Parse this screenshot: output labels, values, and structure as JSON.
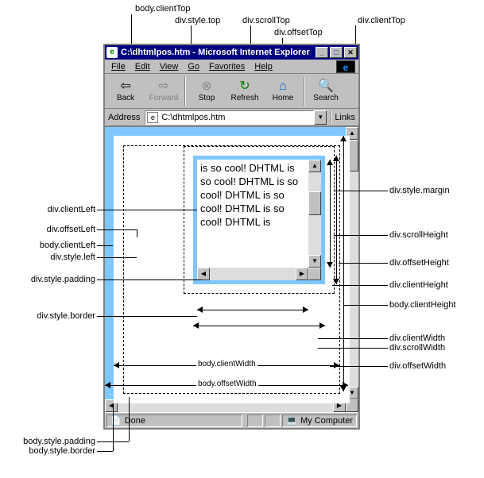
{
  "annotations_top": {
    "body_clientTop": "body.clientTop",
    "div_style_top": "div.style.top",
    "div_scrollTop": "div.scrollTop",
    "div_offsetTop": "div.offsetTop",
    "div_clientTop": "div.clientTop"
  },
  "annotations_left": {
    "div_clientLeft": "div.clientLeft",
    "div_offsetLeft": "div.offsetLeft",
    "body_clientLeft": "body.clientLeft",
    "div_style_left": "div.style.left",
    "div_style_padding": "div.style.padding",
    "div_style_border": "div.style.border",
    "body_style_padding": "body.style.padding",
    "body_style_border": "body.style.border"
  },
  "annotations_right": {
    "div_style_margin": "div.style.margin",
    "div_scrollHeight": "div.scrollHeight",
    "div_offsetHeight": "div.offsetHeight",
    "div_clientHeight": "div.clientHeight",
    "body_clientHeight": "body.clientHeight",
    "div_clientWidth": "div.clientWidth",
    "div_scrollWidth": "div.scrollWidth",
    "div_offsetWidth": "div.offsetWidth"
  },
  "dimensions": {
    "body_clientWidth": "body.clientWidth",
    "body_offsetWidth": "body.offsetWidth"
  },
  "window": {
    "title": "C:\\dhtmlpos.htm - Microsoft Internet Explorer"
  },
  "menubar": [
    "File",
    "Edit",
    "View",
    "Go",
    "Favorites",
    "Help"
  ],
  "toolbar": {
    "back": "Back",
    "forward": "Forward",
    "stop": "Stop",
    "refresh": "Refresh",
    "home": "Home",
    "search": "Search"
  },
  "addressbar": {
    "label": "Address",
    "value": "C:\\dhtmlpos.htm",
    "links": "Links"
  },
  "content_text": "is so cool! DHTML is so cool! DHTML is so cool! DHTML is so cool! DHTML is so cool! DHTML is",
  "statusbar": {
    "done": "Done",
    "zone": "My Computer"
  }
}
